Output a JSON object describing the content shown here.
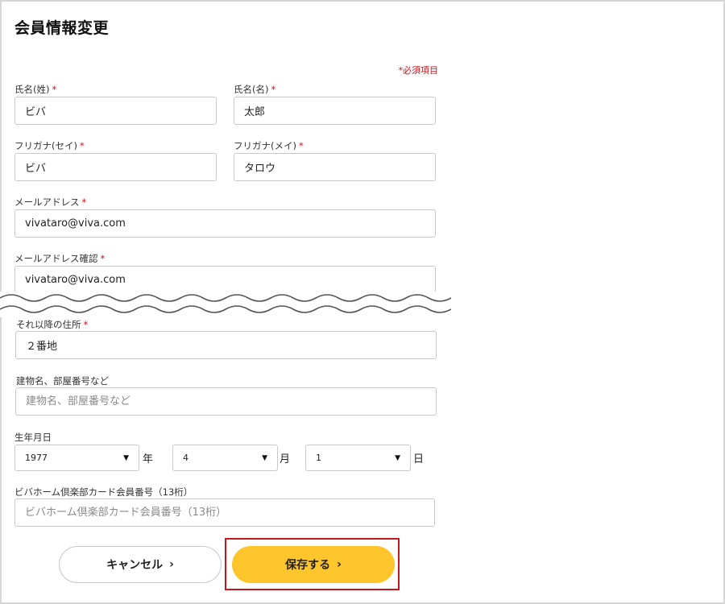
{
  "page": {
    "title": "会員情報変更",
    "required_note": "*必須項目",
    "required_mark": "*"
  },
  "form": {
    "last_name": {
      "label": "氏名(姓)",
      "value": "ビバ"
    },
    "first_name": {
      "label": "氏名(名)",
      "value": "太郎"
    },
    "last_name_kana": {
      "label": "フリガナ(セイ)",
      "value": "ビバ"
    },
    "first_name_kana": {
      "label": "フリガナ(メイ)",
      "value": "タロウ"
    },
    "email": {
      "label": "メールアドレス",
      "value": "vivataro@viva.com"
    },
    "email_confirm": {
      "label": "メールアドレス確認",
      "value": "vivataro@viva.com"
    },
    "address_rest": {
      "label": "それ以降の住所",
      "value": "２番地"
    },
    "building": {
      "label": "建物名、部屋番号など",
      "value": "",
      "placeholder": "建物名、部屋番号など"
    },
    "birthdate": {
      "label": "生年月日",
      "year": "1977",
      "year_unit": "年",
      "month": "4",
      "month_unit": "月",
      "day": "1",
      "day_unit": "日"
    },
    "card_number": {
      "label": "ビバホーム倶楽部カード会員番号（13桁）",
      "value": "",
      "placeholder": "ビバホーム倶楽部カード会員番号（13桁）"
    }
  },
  "actions": {
    "cancel_label": "キャンセル",
    "save_label": "保存する",
    "arrow": "›"
  },
  "icons": {
    "select_chevron": "chevron-down-icon",
    "button_arrow": "chevron-right-icon"
  },
  "colors": {
    "required": "#c8161d",
    "save_button": "#ffc52c",
    "highlight": "#c8161d"
  }
}
